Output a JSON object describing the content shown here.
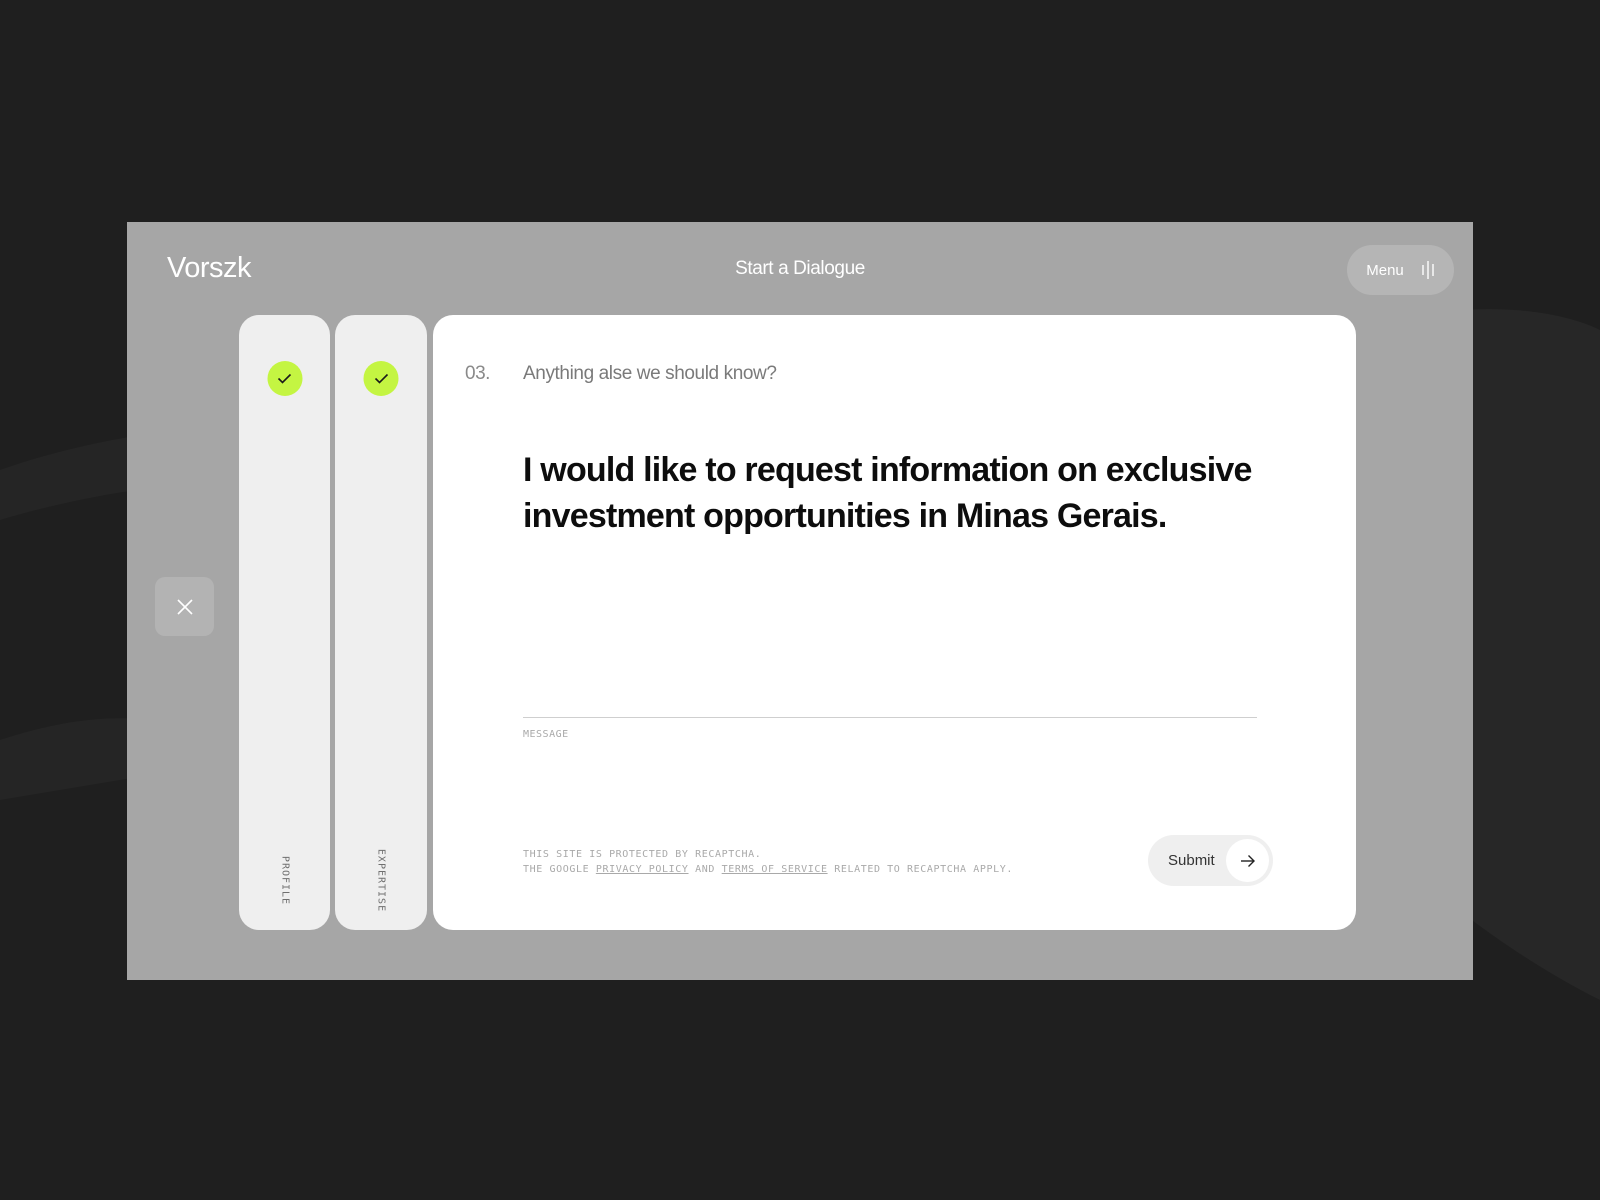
{
  "header": {
    "logo": "Vorszk",
    "title": "Start a Dialogue",
    "menu_label": "Menu"
  },
  "steps": [
    {
      "label": "PROFILE",
      "status": "complete"
    },
    {
      "label": "EXPERTISE",
      "status": "complete"
    }
  ],
  "question": {
    "number": "03.",
    "text": "Anything alse we should know?",
    "answer": "I would like to request information on exclusive investment opportunities in Minas Gerais.",
    "field_label": "MESSAGE"
  },
  "recaptcha": {
    "line1": "THIS SITE IS PROTECTED BY RECAPTCHA.",
    "prefix": "THE GOOGLE",
    "privacy_link": "PRIVACY POLICY",
    "and": "AND",
    "terms_link": "TERMS OF SERVICE",
    "suffix": "RELATED TO RECAPTCHA APPLY."
  },
  "submit": {
    "label": "Submit"
  },
  "colors": {
    "background": "#1f1f1f",
    "window": "#a6a6a6",
    "accent": "#c4f542",
    "card": "#ffffff"
  }
}
